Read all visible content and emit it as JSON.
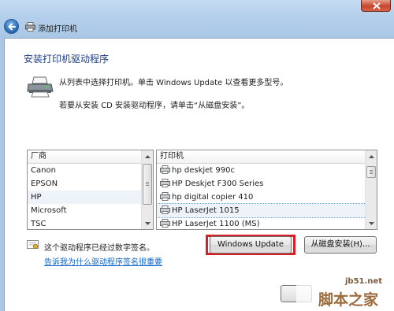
{
  "window": {
    "title": "添加打印机"
  },
  "heading": "安装打印机驱动程序",
  "description": {
    "line1": "从列表中选择打印机。单击 Windows Update 以查看更多型号。",
    "line2": "若要从安装 CD 安装驱动程序，请单击“从磁盘安装”。"
  },
  "manufacturers": {
    "header": "厂商",
    "items": [
      "Canon",
      "EPSON",
      "HP",
      "Microsoft",
      "TSC"
    ],
    "selected": "HP"
  },
  "printers": {
    "header": "打印机",
    "items": [
      "hp deskjet 990c",
      "HP Deskjet F300 Series",
      "hp digital copier 410",
      "HP LaserJet 1015",
      "HP LaserJet 1100 (MS)"
    ],
    "selected": "HP LaserJet 1015"
  },
  "signature": {
    "status": "这个驱动程序已经过数字签名。",
    "link": "告诉我为什么驱动程序签名很重要"
  },
  "buttons": {
    "windows_update": "Windows Update",
    "have_disk": "从磁盘安装(H)..."
  },
  "watermark": {
    "site": "jb51.net",
    "text": "脚本之家"
  },
  "colors": {
    "heading": "#1f3c88",
    "link": "#0f64c8",
    "highlight": "#d81e27",
    "close": "#c8452c"
  }
}
